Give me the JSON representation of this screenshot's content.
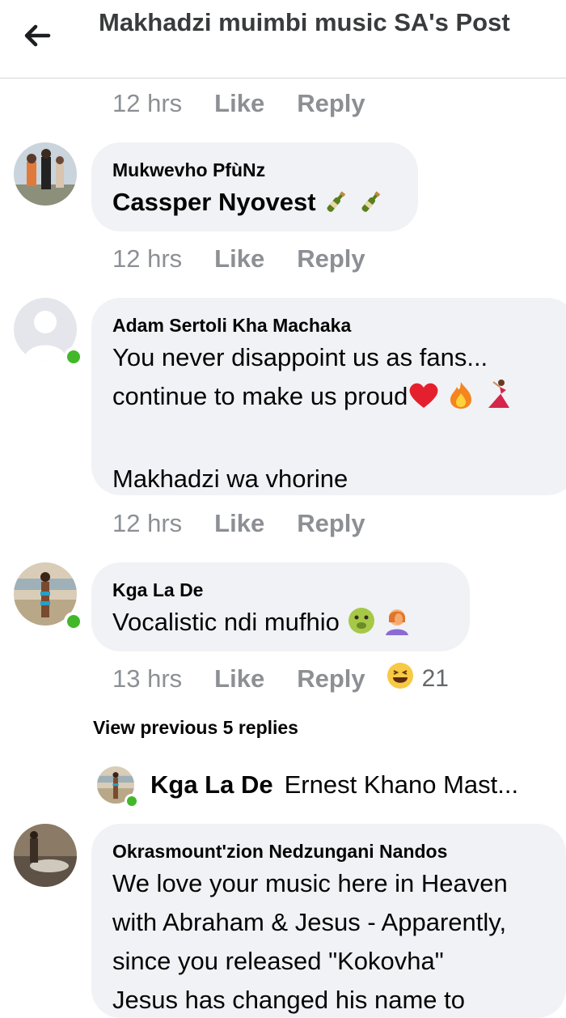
{
  "header": {
    "title": "Makhadzi muimbi music SA's Post"
  },
  "top_actions": {
    "time": "12 hrs",
    "like": "Like",
    "reply": "Reply"
  },
  "comments": [
    {
      "author": "Mukwevho PfùNz",
      "text": "Cassper Nyovest",
      "emojis": [
        "bottle-with-popping-cork",
        "bottle-with-popping-cork"
      ],
      "time": "12 hrs",
      "like": "Like",
      "reply": "Reply"
    },
    {
      "author": "Adam Sertoli Kha Machaka",
      "line1": "You never disappoint us as fans...",
      "line2": "continue to make us proud",
      "line3": "Makhadzi wa vhorine",
      "emojis": [
        "red-heart",
        "fire",
        "dancer"
      ],
      "time": "12 hrs",
      "like": "Like",
      "reply": "Reply"
    },
    {
      "author": "Kga La De",
      "text": "Vocalistic ndi mufhio",
      "emojis": [
        "nauseated-face",
        "woman-facepalming"
      ],
      "time": "13 hrs",
      "like": "Like",
      "reply": "Reply",
      "reaction": "laughing-face",
      "reaction_count": "21"
    }
  ],
  "view_previous": "View previous 5 replies",
  "reply_preview": {
    "author": "Kga La De",
    "text": "Ernest Khano Mast..."
  },
  "last_comment": {
    "author": "Okrasmount'zion Nedzungani Nandos",
    "line1": "We love your music here in Heaven",
    "line2": "with Abraham & Jesus - Apparently,",
    "line3": "since you released \"Kokovha\"",
    "line4": "Jesus has changed his name to"
  },
  "colors": {
    "online": "#42b72a",
    "bubble": "#f0f2f5",
    "meta_text": "#8c8f94"
  }
}
